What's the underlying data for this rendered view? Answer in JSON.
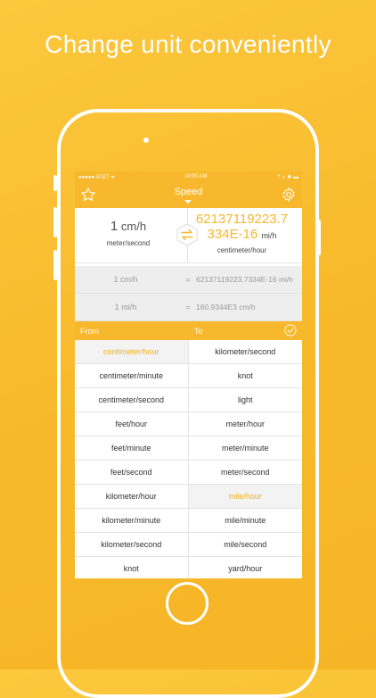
{
  "headline": "Change unit conveniently",
  "status": {
    "carrier": "●●●●● AT&T ᯤ",
    "time": "10:00 AM",
    "right": "⇡ ◐ ✱ ▬"
  },
  "nav": {
    "title": "Speed",
    "star_icon": "star-icon",
    "gear_icon": "gear-icon"
  },
  "converter": {
    "from_value": "1",
    "from_unit": "cm/h",
    "from_name": "meter/second",
    "to_value_line1": "62137119223.7",
    "to_value_line2": "334E-16",
    "to_unit": "mi/h",
    "to_name": "centimeter/hour"
  },
  "results": [
    {
      "left": "1 cm/h",
      "eq": "=",
      "right": "62137119223.7334E-16 mi/h"
    },
    {
      "left": "1 mi/h",
      "eq": "=",
      "right": "160.9344E3 cm/h"
    }
  ],
  "header": {
    "from": "From",
    "to": "To"
  },
  "from_list": [
    "centimeter/hour",
    "centimeter/minute",
    "centimeter/second",
    "feet/hour",
    "feet/minute",
    "feet/second",
    "kilometer/hour",
    "kilometer/minute",
    "kilometer/second",
    "knot"
  ],
  "to_list": [
    "kilometer/second",
    "knot",
    "light",
    "meter/hour",
    "meter/minute",
    "meter/second",
    "mile/hour",
    "mile/minute",
    "mile/second",
    "yard/hour"
  ],
  "selected": {
    "from_index": 0,
    "to_index": 6
  },
  "colors": {
    "accent": "#f8b82d",
    "selected_text": "#f0b124"
  }
}
